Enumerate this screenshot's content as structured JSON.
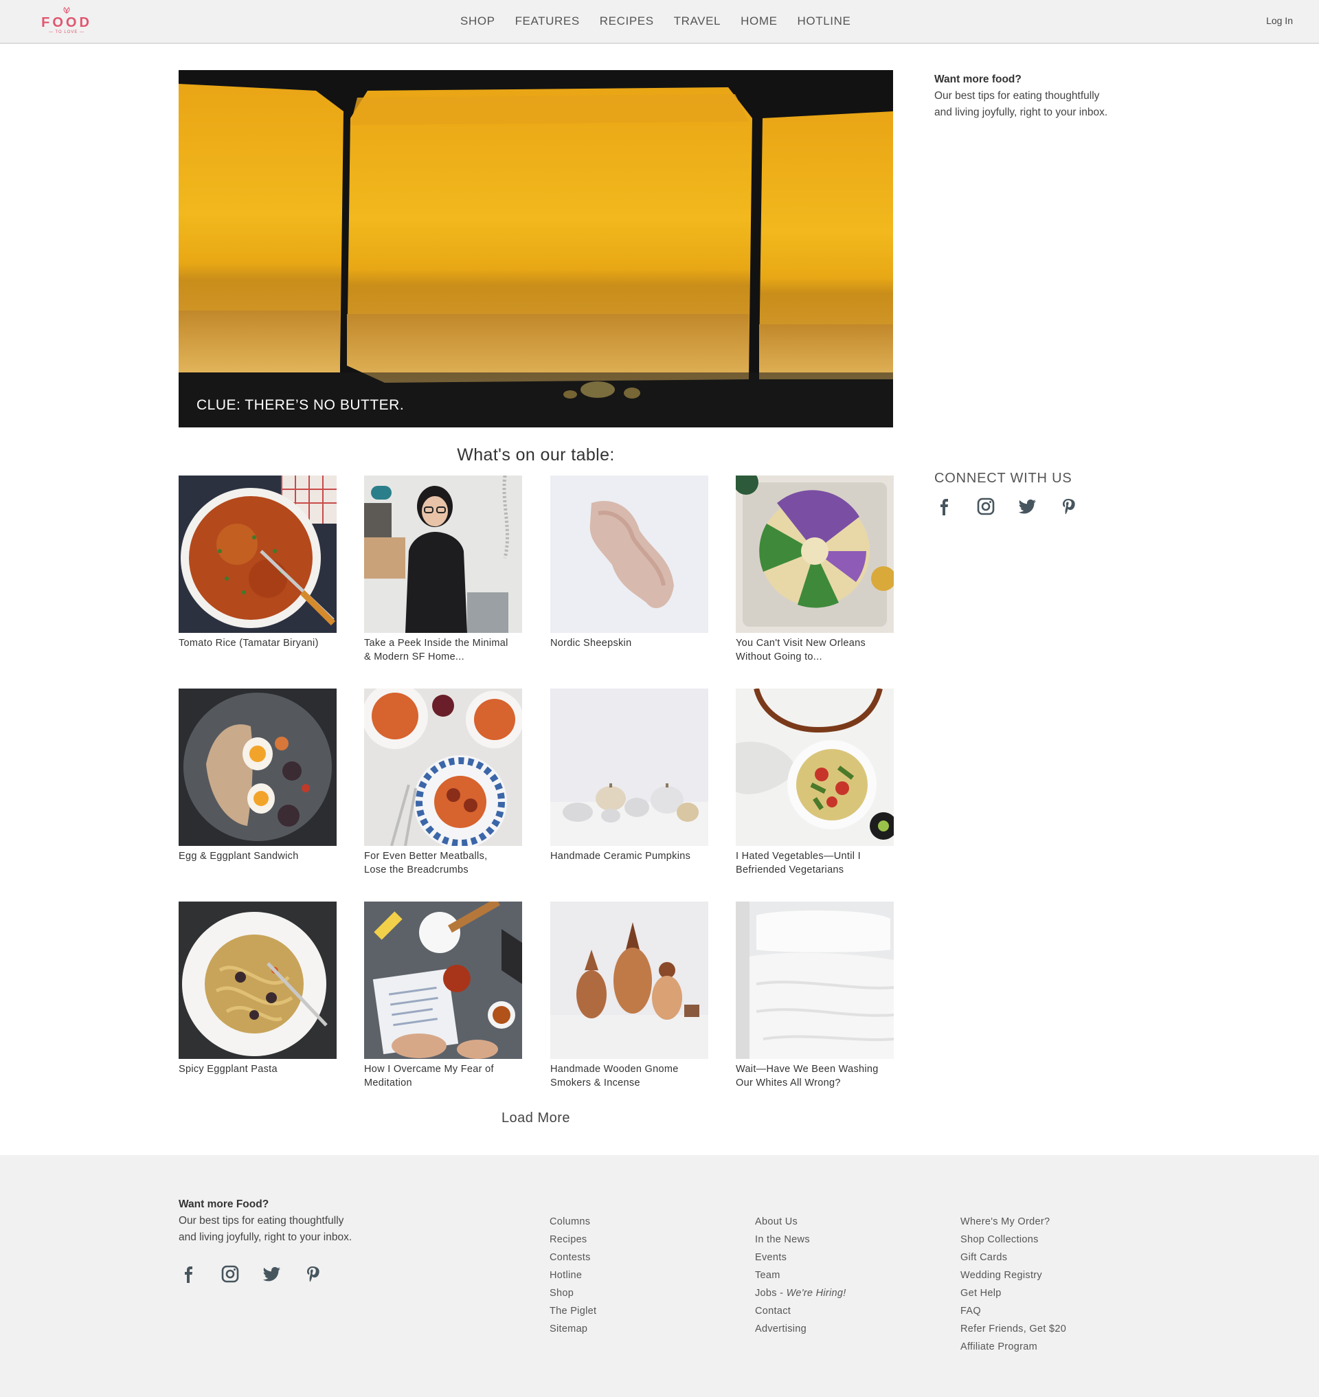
{
  "header": {
    "logo_word": "FOOD",
    "logo_sub": "— TO LOVE —",
    "nav": [
      "SHOP",
      "FEATURES",
      "RECIPES",
      "TRAVEL",
      "HOME",
      "HOTLINE"
    ],
    "login": "Log In"
  },
  "hero": {
    "caption": "CLUE: THERE’S NO BUTTER."
  },
  "sidebar": {
    "newsletter_title": "Want more food?",
    "newsletter_line1": "Our best tips for eating thoughtfully",
    "newsletter_line2": "and living joyfully, right to your inbox.",
    "connect_title": "CONNECT WITH US",
    "social": [
      "facebook-icon",
      "instagram-icon",
      "twitter-icon",
      "pinterest-icon"
    ]
  },
  "section_title": "What's on our table:",
  "cards": [
    {
      "line1": "Tomato Rice (Tamatar Biryani)",
      "line2": ""
    },
    {
      "line1": "Take a Peek Inside the Minimal",
      "line2": "& Modern SF Home..."
    },
    {
      "line1": "Nordic Sheepskin",
      "line2": ""
    },
    {
      "line1": "You Can't Visit New Orleans",
      "line2": "Without Going to..."
    },
    {
      "line1": "Egg & Eggplant Sandwich",
      "line2": ""
    },
    {
      "line1": "For Even Better Meatballs,",
      "line2": "Lose the Breadcrumbs"
    },
    {
      "line1": "Handmade Ceramic Pumpkins",
      "line2": ""
    },
    {
      "line1": "I Hated Vegetables—Until I",
      "line2": "Befriended Vegetarians"
    },
    {
      "line1": "Spicy Eggplant Pasta",
      "line2": ""
    },
    {
      "line1": "How I Overcame My Fear of",
      "line2": "Meditation"
    },
    {
      "line1": "Handmade Wooden Gnome",
      "line2": "Smokers & Incense"
    },
    {
      "line1": "Wait—Have We Been Washing",
      "line2": "Our Whites All Wrong?"
    }
  ],
  "load_more": "Load More",
  "footer": {
    "newsletter_title": "Want more Food?",
    "newsletter_line1": "Our best tips for eating thoughtfully",
    "newsletter_line2": "and living joyfully, right to your inbox.",
    "col1": [
      "Columns",
      "Recipes",
      "Contests",
      "Hotline",
      "Shop",
      "The Piglet",
      "Sitemap"
    ],
    "col2": [
      "About Us",
      "In the News",
      "Events",
      "Team",
      "Jobs - ",
      "Contact",
      "Advertising"
    ],
    "col2_jobs_em": "We're Hiring!",
    "col3": [
      "Where's My Order?",
      "Shop Collections",
      "Gift Cards",
      "Wedding Registry",
      "Get Help",
      "FAQ",
      "Refer Friends, Get $20",
      "Affiliate Program"
    ]
  }
}
